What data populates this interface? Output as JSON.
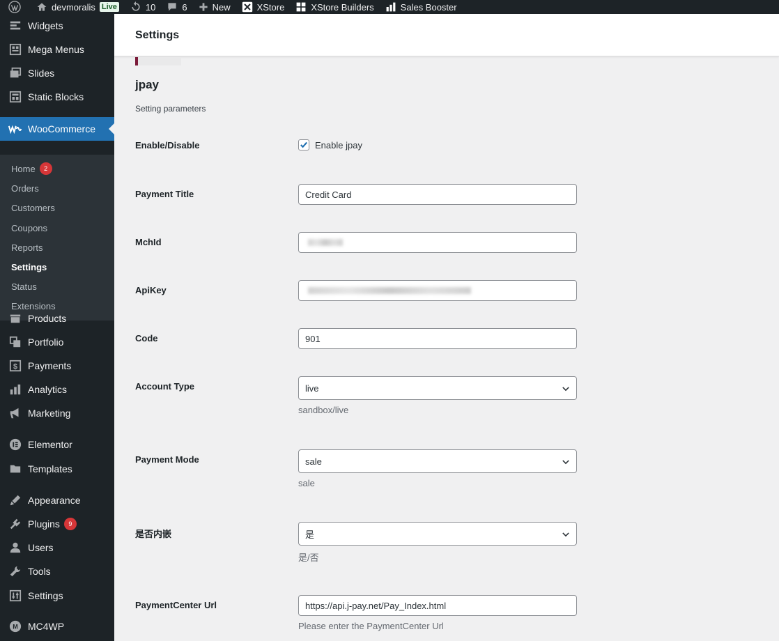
{
  "adminbar": {
    "site_name": "devmoralis",
    "live_badge": "Live",
    "updates_count": "10",
    "comments_count": "6",
    "new_label": "New",
    "xstore_label": "XStore",
    "xstore_builders_label": "XStore Builders",
    "sales_booster_label": "Sales Booster"
  },
  "sidebar": {
    "items": [
      {
        "label": "Widgets",
        "icon": "widgets-icon"
      },
      {
        "label": "Mega Menus",
        "icon": "mega-menus-icon"
      },
      {
        "label": "Slides",
        "icon": "slides-icon"
      },
      {
        "label": "Static Blocks",
        "icon": "static-blocks-icon"
      },
      {
        "label": "WooCommerce",
        "icon": "woocommerce-icon"
      },
      {
        "label": "Products",
        "icon": "products-icon"
      },
      {
        "label": "Portfolio",
        "icon": "portfolio-icon"
      },
      {
        "label": "Payments",
        "icon": "payments-icon"
      },
      {
        "label": "Analytics",
        "icon": "analytics-icon"
      },
      {
        "label": "Marketing",
        "icon": "marketing-icon"
      },
      {
        "label": "Elementor",
        "icon": "elementor-icon"
      },
      {
        "label": "Templates",
        "icon": "templates-icon"
      },
      {
        "label": "Appearance",
        "icon": "appearance-icon"
      },
      {
        "label": "Plugins",
        "icon": "plugins-icon",
        "badge": "9"
      },
      {
        "label": "Users",
        "icon": "users-icon"
      },
      {
        "label": "Tools",
        "icon": "tools-icon"
      },
      {
        "label": "Settings",
        "icon": "settings-icon"
      },
      {
        "label": "MC4WP",
        "icon": "mc4wp-icon"
      }
    ],
    "submenu": [
      {
        "label": "Home",
        "badge": "2"
      },
      {
        "label": "Orders"
      },
      {
        "label": "Customers"
      },
      {
        "label": "Coupons"
      },
      {
        "label": "Reports"
      },
      {
        "label": "Settings"
      },
      {
        "label": "Status"
      },
      {
        "label": "Extensions"
      }
    ]
  },
  "header": {
    "title": "Settings"
  },
  "section": {
    "title": "jpay",
    "description": "Setting parameters"
  },
  "fields": {
    "enable": {
      "label": "Enable/Disable",
      "checkbox_label": "Enable jpay",
      "checked": true
    },
    "payment_title": {
      "label": "Payment Title",
      "value": "Credit Card"
    },
    "mchid": {
      "label": "MchId"
    },
    "apikey": {
      "label": "ApiKey"
    },
    "code": {
      "label": "Code",
      "value": "901"
    },
    "account_type": {
      "label": "Account Type",
      "value": "live",
      "description": "sandbox/live"
    },
    "payment_mode": {
      "label": "Payment Mode",
      "value": "sale",
      "description": "sale"
    },
    "embedded": {
      "label": "是否内嵌",
      "value": "是",
      "description": "是/否"
    },
    "payment_center_url": {
      "label": "PaymentCenter Url",
      "value": "https://api.j-pay.net/Pay_Index.html",
      "description": "Please enter the PaymentCenter Url"
    }
  },
  "colors": {
    "admin_bg": "#1d2327",
    "active_menu": "#2271b1",
    "submenu_bg": "#2c3338",
    "badge": "#d63638",
    "checkbox_check": "#2271b1"
  }
}
